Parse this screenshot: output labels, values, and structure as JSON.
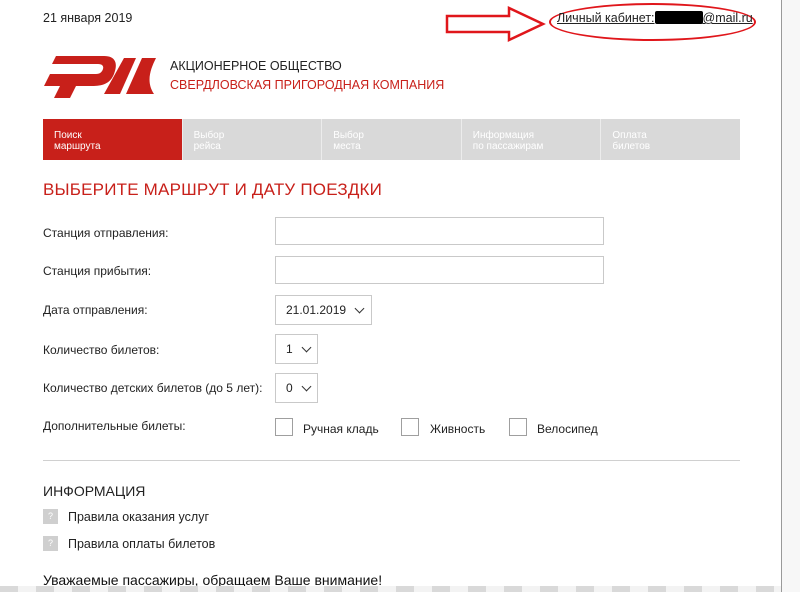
{
  "header": {
    "date": "21 января 2019",
    "cabinet_prefix": "Личный кабинет:",
    "cabinet_suffix": "@mail.ru"
  },
  "company": {
    "line1": "АКЦИОНЕРНОЕ ОБЩЕСТВО",
    "line2": "СВЕРДЛОВСКАЯ ПРИГОРОДНАЯ КОМПАНИЯ"
  },
  "steps": [
    {
      "line1": "Поиск",
      "line2": "маршрута"
    },
    {
      "line1": "Выбор",
      "line2": "рейса"
    },
    {
      "line1": "Выбор",
      "line2": "места"
    },
    {
      "line1": "Информация",
      "line2": "по пассажирам"
    },
    {
      "line1": "Оплата",
      "line2": "билетов"
    }
  ],
  "form": {
    "title": "ВЫБЕРИТЕ МАРШРУТ И ДАТУ ПОЕЗДКИ",
    "departure_label": "Станция отправления:",
    "arrival_label": "Станция прибытия:",
    "date_label": "Дата отправления:",
    "date_value": "21.01.2019",
    "tickets_label": "Количество билетов:",
    "tickets_value": "1",
    "child_label": "Количество детских билетов (до 5 лет):",
    "child_value": "0",
    "extra_label": "Дополнительные билеты:",
    "extra": [
      "Ручная кладь",
      "Живность",
      "Велосипед"
    ]
  },
  "info": {
    "title": "ИНФОРМАЦИЯ",
    "icon": "?",
    "links": [
      "Правила оказания услуг",
      "Правила оплаты билетов"
    ],
    "notice": "Уважаемые пассажиры, обращаем Ваше внимание!"
  },
  "colors": {
    "brand_red": "#c8201a",
    "step_inactive": "#d9d9d9",
    "annotation_red": "#e0161b"
  },
  "annotation": {
    "arrow": "arrow-right-outline",
    "highlight": "red-oval"
  }
}
